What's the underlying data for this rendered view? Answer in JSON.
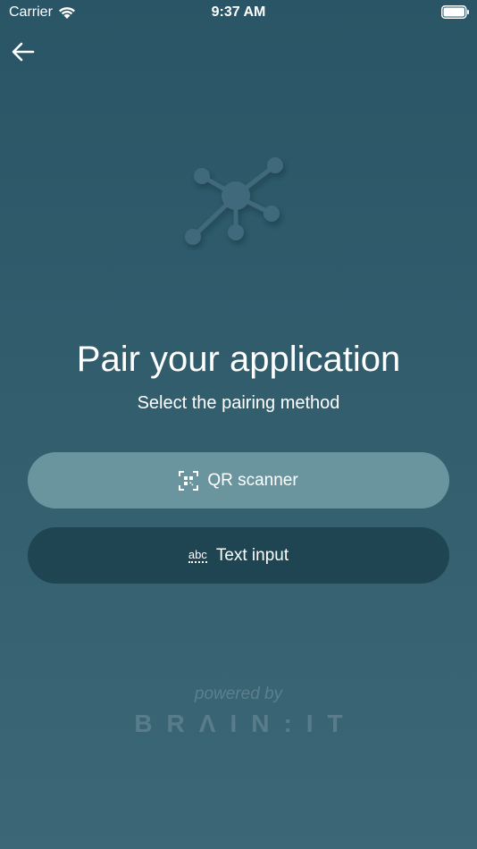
{
  "status_bar": {
    "carrier": "Carrier",
    "time": "9:37 AM"
  },
  "header": {
    "back_icon": "arrow-left-icon"
  },
  "hero": {
    "icon": "network-hub-icon",
    "icon_color": "#3f6b7b"
  },
  "main": {
    "title": "Pair your application",
    "subtitle": "Select the pairing method"
  },
  "buttons": {
    "qr": {
      "label": "QR scanner",
      "icon": "qr-scan-icon",
      "color": "#6a959f"
    },
    "text": {
      "label": "Text input",
      "icon_text": "abc",
      "icon": "abc-icon",
      "color": "#1f4552"
    }
  },
  "footer": {
    "powered_by": "powered by",
    "brand": "BRΛIN:IT"
  }
}
